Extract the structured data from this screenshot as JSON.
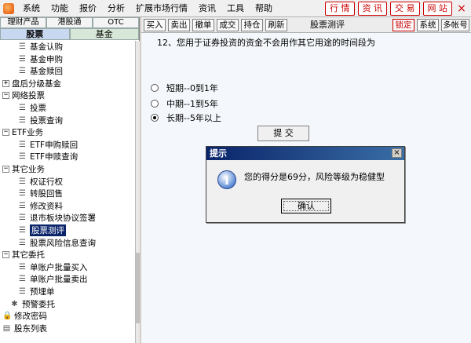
{
  "menubar": {
    "items": [
      "系统",
      "功能",
      "报价",
      "分析",
      "扩展市场行情",
      "资讯",
      "工具",
      "帮助"
    ],
    "top_buttons": [
      "行 情",
      "资 讯",
      "交 易",
      "网 站"
    ],
    "close": "×"
  },
  "left": {
    "tabs_row1": [
      "理财产品",
      "港股通",
      "OTC"
    ],
    "tabs_row2": [
      "股票",
      "基金"
    ],
    "tree": [
      {
        "label": "基金认购",
        "type": "leaf",
        "indent": 2,
        "icon": "doc-icon"
      },
      {
        "label": "基金申购",
        "type": "leaf",
        "indent": 2,
        "icon": "doc-icon"
      },
      {
        "label": "基金赎回",
        "type": "leaf",
        "indent": 2,
        "icon": "doc-icon"
      },
      {
        "label": "盘后分级基金",
        "type": "folder",
        "indent": 0,
        "expander": "+"
      },
      {
        "label": "网络投票",
        "type": "folder",
        "indent": 0,
        "expander": "−"
      },
      {
        "label": "投票",
        "type": "leaf",
        "indent": 2,
        "icon": "doc-icon"
      },
      {
        "label": "投票查询",
        "type": "leaf",
        "indent": 2,
        "icon": "doc-icon"
      },
      {
        "label": "ETF业务",
        "type": "folder",
        "indent": 0,
        "expander": "−"
      },
      {
        "label": "ETF申购赎回",
        "type": "leaf",
        "indent": 2,
        "icon": "doc-icon"
      },
      {
        "label": "ETF申赎查询",
        "type": "leaf",
        "indent": 2,
        "icon": "doc-icon"
      },
      {
        "label": "其它业务",
        "type": "folder",
        "indent": 0,
        "expander": "−"
      },
      {
        "label": "权证行权",
        "type": "leaf",
        "indent": 2,
        "icon": "doc-icon"
      },
      {
        "label": "转股回售",
        "type": "leaf",
        "indent": 2,
        "icon": "doc-icon"
      },
      {
        "label": "修改资料",
        "type": "leaf",
        "indent": 2,
        "icon": "doc-icon"
      },
      {
        "label": "退市板块协议签署",
        "type": "leaf",
        "indent": 2,
        "icon": "doc-icon"
      },
      {
        "label": "股票测评",
        "type": "leaf",
        "indent": 2,
        "icon": "doc-icon",
        "selected": true
      },
      {
        "label": "股票风险信息查询",
        "type": "leaf",
        "indent": 2,
        "icon": "doc-icon"
      },
      {
        "label": "其它委托",
        "type": "folder",
        "indent": 0,
        "expander": "−"
      },
      {
        "label": "单账户批量买入",
        "type": "leaf",
        "indent": 2,
        "icon": "doc-icon"
      },
      {
        "label": "单账户批量卖出",
        "type": "leaf",
        "indent": 2,
        "icon": "doc-icon"
      },
      {
        "label": "预埋单",
        "type": "leaf",
        "indent": 2,
        "icon": "doc-icon"
      },
      {
        "label": "预警委托",
        "type": "leaf",
        "indent": 1,
        "icon": "alarm-icon"
      },
      {
        "label": "修改密码",
        "type": "leaf",
        "indent": 0,
        "icon": "lock-icon"
      },
      {
        "label": "股东列表",
        "type": "leaf",
        "indent": 0,
        "icon": "list-icon"
      }
    ]
  },
  "toolbar": {
    "buttons": [
      "买入",
      "卖出",
      "撤单",
      "成交",
      "持仓",
      "刷新"
    ],
    "title": "股票测评",
    "right_buttons": [
      "锁定",
      "系统",
      "多帐号"
    ]
  },
  "question": {
    "text": "12、您用于证券投资的资金不会用作其它用途的时间段为",
    "options": [
      "短期--0到1年",
      "中期--1到5年",
      "长期--5年以上"
    ],
    "selected": 2,
    "submit_label": "提 交"
  },
  "dialog": {
    "title": "提示",
    "icon": "i",
    "message": "您的得分是69分，风险等级为稳健型",
    "ok_label": "确认",
    "close": "×"
  }
}
